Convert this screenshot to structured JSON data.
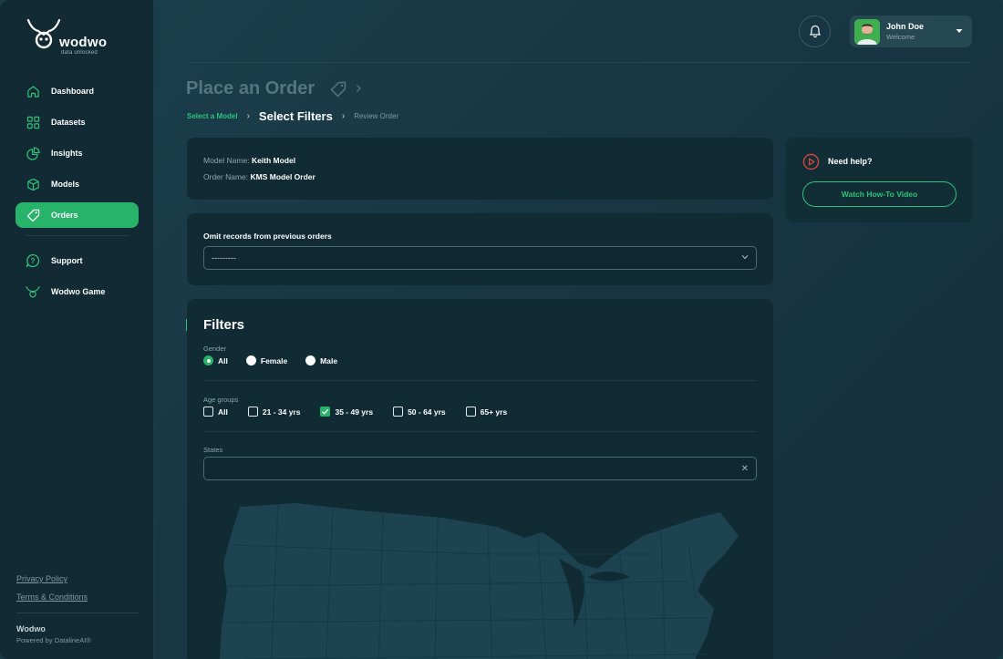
{
  "brand": {
    "logo_word": "wodwo",
    "logo_tagline": "data unlocked",
    "footer_name": "Wodwo",
    "footer_powered": "Powered by DatalineAI®"
  },
  "sidebar": {
    "items": [
      {
        "label": "Dashboard",
        "icon": "home-icon"
      },
      {
        "label": "Datasets",
        "icon": "grid-icon"
      },
      {
        "label": "Insights",
        "icon": "pie-chart-icon"
      },
      {
        "label": "Models",
        "icon": "cube-icon"
      },
      {
        "label": "Orders",
        "icon": "tag-icon",
        "active": true
      }
    ],
    "secondary": [
      {
        "label": "Support",
        "icon": "help-chat-icon"
      },
      {
        "label": "Wodwo Game",
        "icon": "wodwo-mark-icon"
      }
    ],
    "links": [
      "Privacy Policy",
      "Terms & Conditions"
    ]
  },
  "header": {
    "user_name": "John Doe",
    "user_subtitle": "Welcome"
  },
  "page": {
    "title": "Place an Order",
    "breadcrumb": [
      "Select a Model",
      "Select Filters",
      "Review Order"
    ]
  },
  "summary": {
    "model_label": "Model Name:",
    "model_value": "Keith Model",
    "order_label": "Order Name:",
    "order_value": "KMS Model Order"
  },
  "omit": {
    "label": "Omit records from previous orders",
    "value": "---------"
  },
  "filters": {
    "title": "Filters",
    "gender_label": "Gender",
    "gender_options": [
      "All",
      "Female",
      "Male"
    ],
    "gender_selected": "All",
    "age_label": "Age groups",
    "age_options": [
      "All",
      "21 - 34 yrs",
      "35 - 49 yrs",
      "50 - 64 yrs",
      "65+ yrs"
    ],
    "age_checked": [
      "35 - 49 yrs"
    ],
    "states_label": "States",
    "states_clear": "✕"
  },
  "help": {
    "title": "Need help?",
    "button": "Watch How-To Video"
  },
  "colors": {
    "accent": "#27b36a",
    "sidebar_bg": "#112a33",
    "card_bg": "#102b34",
    "alert_red": "#e0463c"
  }
}
